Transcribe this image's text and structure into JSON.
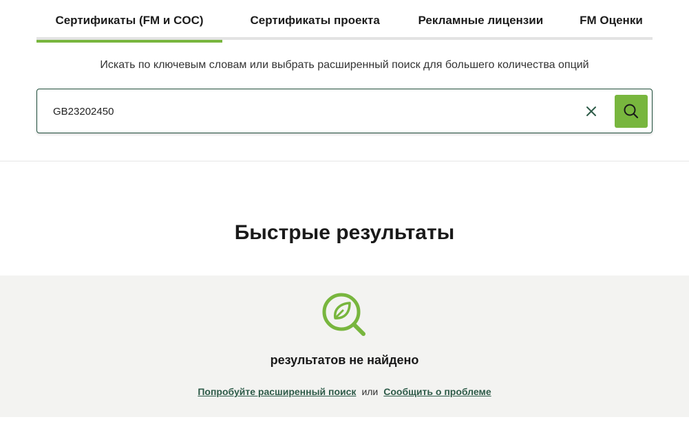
{
  "tabs": [
    {
      "label": "Сертификаты (FM и COC)",
      "active": true
    },
    {
      "label": "Сертификаты проекта",
      "active": false
    },
    {
      "label": "Рекламные лицензии",
      "active": false
    },
    {
      "label": "FM Оценки",
      "active": false
    }
  ],
  "search": {
    "hint": "Искать по ключевым словам или выбрать расширенный поиск для большего количества опций",
    "value": "GB23202450"
  },
  "quick_results": {
    "title": "Быстрые результаты",
    "empty_message": "результатов не найдено",
    "advanced_search_link": "Попробуйте расширенный поиск",
    "or_text": "или",
    "report_problem_link": "Сообщить о проблеме"
  },
  "colors": {
    "accent_green": "#78b63e",
    "dark_green": "#1f4d3a",
    "link_green": "#2e5b49"
  },
  "icons": {
    "clear": "close-icon",
    "search": "search-icon",
    "empty": "leaf-magnifier-icon"
  }
}
